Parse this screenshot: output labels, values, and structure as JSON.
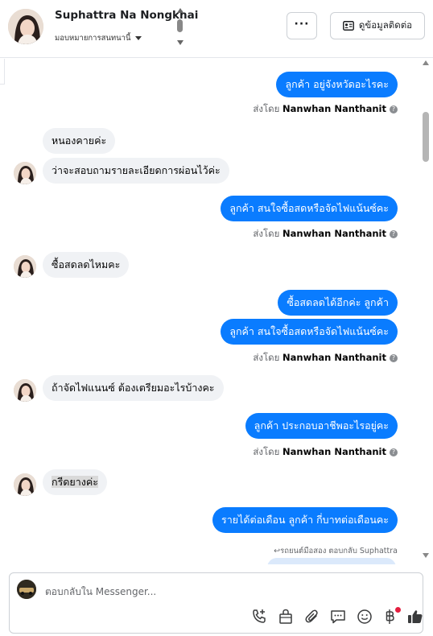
{
  "header": {
    "contact_name": "Suphattra Na Nongkhai",
    "assign_label": "มอบหมายการสนทนานี้",
    "more_label": "···",
    "view_contact_label": "ดูข้อมูลติดต่อ"
  },
  "messages": [
    {
      "dir": "out",
      "text": "ลูกค้า อยู่จังหวัดอะไรคะ"
    },
    {
      "dir": "meta",
      "prefix": "ส่งโดย",
      "sender": "Nanwhan Nanthanit"
    },
    {
      "dir": "in",
      "text": "หนองคายค่ะ"
    },
    {
      "dir": "in",
      "text": "ว่าจะสอบถามรายละเอียดการผ่อนไว้ค่ะ"
    },
    {
      "dir": "out",
      "text": "ลูกค้า สนใจซื้อสดหรือจัดไฟแน้นซ์คะ"
    },
    {
      "dir": "meta",
      "prefix": "ส่งโดย",
      "sender": "Nanwhan Nanthanit"
    },
    {
      "dir": "in",
      "text": "ซื้อสดลดไหมคะ"
    },
    {
      "dir": "out",
      "text": "ซื้อสดลดได้อีกค่ะ ลูกค้า"
    },
    {
      "dir": "out",
      "text": "ลูกค้า สนใจซื้อสดหรือจัดไฟแน้นซ์คะ"
    },
    {
      "dir": "meta",
      "prefix": "ส่งโดย",
      "sender": "Nanwhan Nanthanit"
    },
    {
      "dir": "in",
      "text": "ถ้าจัดไฟแนนซ์ ต้องเตรียมอะไรบ้างคะ"
    },
    {
      "dir": "out",
      "text": "ลูกค้า ประกอบอาชีพอะไรอยู่คะ"
    },
    {
      "dir": "meta",
      "prefix": "ส่งโดย",
      "sender": "Nanwhan Nanthanit"
    },
    {
      "dir": "in",
      "text": "กรีดยางค่ะ"
    },
    {
      "dir": "out",
      "text": "รายได้ต่อเดือน ลูกค้า กี่บาทต่อเดือนคะ"
    }
  ],
  "reply_note": "รถยนต์มือสอง ตอบกลับ Suphattra",
  "composer": {
    "placeholder": "ตอบกลับใน Messenger...",
    "tools": [
      "add-call-icon",
      "gift-bag-icon",
      "paperclip-icon",
      "quick-reply-icon",
      "emoji-icon",
      "payment-icon",
      "like-icon"
    ]
  },
  "colors": {
    "outgoing_bubble": "#0a7cff",
    "incoming_bubble": "#f0f2f5",
    "notification_dot": "#e41e3f"
  }
}
